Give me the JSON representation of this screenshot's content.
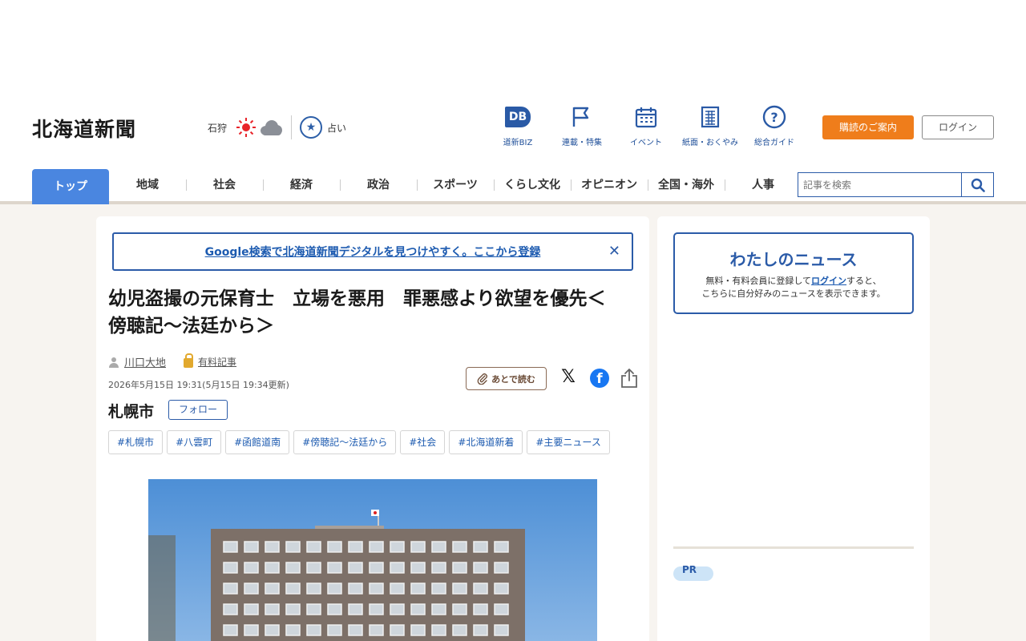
{
  "header": {
    "logo": "北海道新聞",
    "weather": {
      "city": "石狩",
      "icons": [
        "sun-icon",
        "cloud-icon"
      ]
    },
    "fortune_label": "占い",
    "quick_links": [
      {
        "label": "道新BIZ",
        "icon": "dbiz-icon"
      },
      {
        "label": "連載・特集",
        "icon": "flag-icon"
      },
      {
        "label": "イベント",
        "icon": "calendar-icon"
      },
      {
        "label": "紙面・おくやみ",
        "icon": "newspaper-icon"
      },
      {
        "label": "総合ガイド",
        "icon": "question-icon"
      }
    ],
    "subscribe_label": "購読のご案内",
    "login_label": "ログイン"
  },
  "nav": {
    "tabs": [
      "トップ",
      "地域",
      "社会",
      "経済",
      "政治",
      "スポーツ",
      "くらし文化",
      "オピニオン",
      "全国・海外",
      "人事"
    ],
    "active_index": 0
  },
  "search": {
    "placeholder": "記事を検索"
  },
  "banner": {
    "text": "Google検索で北海道新聞デジタルを見つけやすく。ここから登録"
  },
  "article": {
    "headline_line1": "幼児盗撮の元保育士　立場を悪用　罪悪感より欲望を優先＜",
    "headline_line2": "傍聴記～法廷から＞",
    "author": "川口大地",
    "paid_label": "有料記事",
    "date": "2026年5月15日 19:31(5月15日 19:34更新)",
    "read_later_label": "あとで読む",
    "location": "札幌市",
    "follow_label": "フォロー",
    "tags": [
      "#札幌市",
      "#八雲町",
      "#函館道南",
      "#傍聴記～法廷から",
      "#社会",
      "#北海道新着",
      "#主要ニュース"
    ]
  },
  "sidebar": {
    "mynews_title": "わたしのニュース",
    "mynews_text_before": "無料・有料会員に登録して",
    "mynews_link": "ログイン",
    "mynews_text_after": "すると、",
    "mynews_text_line2": "こちらに自分好みのニュースを表示できます。",
    "pr_label": "PR"
  },
  "colors": {
    "brand_blue": "#2b5ba8",
    "nav_active": "#4a86e0",
    "subscribe_orange": "#ef7d1b",
    "page_bg": "#f7f4f0"
  }
}
